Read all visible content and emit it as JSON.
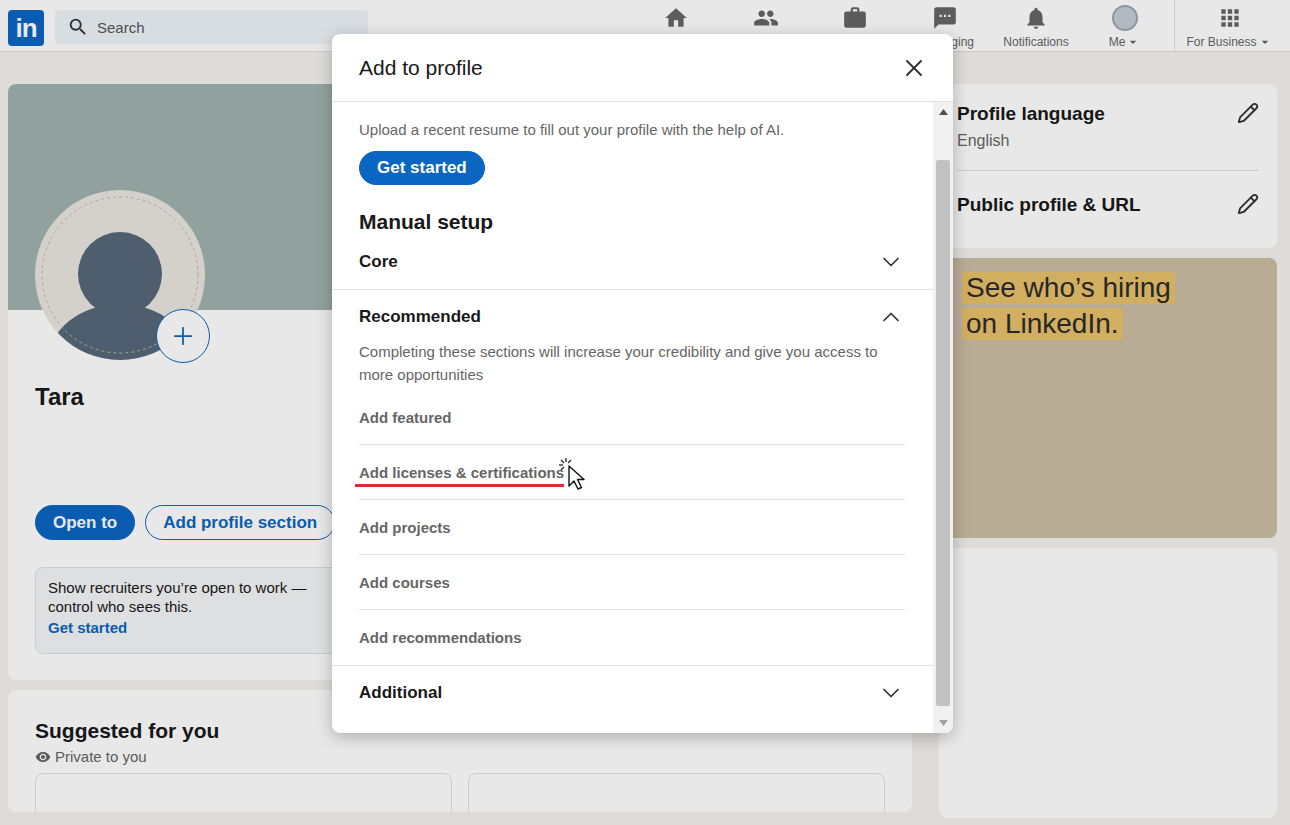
{
  "nav": {
    "logo": "in",
    "search": {
      "placeholder": "Search"
    },
    "items": [
      {
        "kind": "home"
      },
      {
        "kind": "network"
      },
      {
        "kind": "jobs"
      },
      {
        "kind": "messaging",
        "label": "ging"
      },
      {
        "kind": "notifications",
        "label": "Notifications"
      },
      {
        "kind": "me",
        "label": "Me",
        "dropdown": true
      },
      {
        "kind": "business",
        "label": "For Business",
        "dropdown": true
      }
    ]
  },
  "profile": {
    "name": "Tara",
    "buttons": [
      {
        "label": "Open to",
        "primary": true
      },
      {
        "label": "Add profile section",
        "primary": false
      }
    ],
    "open_to_work": {
      "text": "Show recruiters you’re open to work — control who sees this.",
      "link": "Get started"
    }
  },
  "suggested": {
    "title": "Suggested for you",
    "visibility": "Private to you"
  },
  "sidebar": {
    "settings": [
      {
        "title": "Profile language",
        "value": "English"
      },
      {
        "title": "Public profile & URL"
      }
    ],
    "ad": {
      "headline": [
        "See who’s hiring",
        "on LinkedIn."
      ]
    }
  },
  "modal": {
    "title": "Add to profile",
    "intro": "Upload a recent resume to fill out your profile with the help of AI.",
    "intro_button": "Get started",
    "heading": "Manual setup",
    "sections": [
      {
        "title": "Core",
        "expanded": false
      },
      {
        "title": "Recommended",
        "expanded": true,
        "description": "Completing these sections will increase your credibility and give you access to more opportunities",
        "items": [
          {
            "label": "Add featured",
            "highlighted": false
          },
          {
            "label": "Add licenses & certifications",
            "highlighted": true
          },
          {
            "label": "Add projects",
            "highlighted": false
          },
          {
            "label": "Add courses",
            "highlighted": false
          },
          {
            "label": "Add recommendations",
            "highlighted": false
          }
        ]
      },
      {
        "title": "Additional",
        "expanded": false
      }
    ]
  }
}
